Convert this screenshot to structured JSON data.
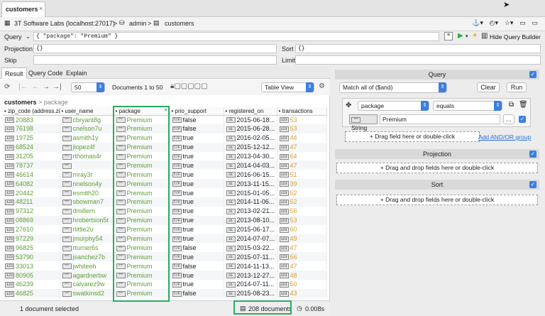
{
  "tab": {
    "title": "customers",
    "close": "×"
  },
  "breadcrumb": {
    "connection": "3T Software Labs (localhost:27017)",
    "sep1": ">",
    "database": "admin",
    "sep2": ">",
    "collection": "customers"
  },
  "query_bar": {
    "query_label": "Query",
    "query_value": "{ \"package\": \"Premium\" }",
    "projection_label": "Projection",
    "projection_value": "{}",
    "sort_label": "Sort",
    "sort_value": "{}",
    "skip_label": "Skip",
    "skip_value": "",
    "limit_label": "Limit",
    "limit_value": "",
    "query_builder_label": "Hide Query Builder"
  },
  "result_tabs": [
    "Result",
    "Query Code",
    "Explain"
  ],
  "toolbar": {
    "page_size": "50",
    "documents_range": "Documents 1 to 50",
    "view_mode": "Table View"
  },
  "path": {
    "collection": "customers",
    "sep": ">",
    "field": "package"
  },
  "columns": [
    "zip_code (address.zip",
    "user_name",
    "package",
    "prio_support",
    "registered_on",
    "transactions"
  ],
  "rows": [
    [
      "20883",
      "cbryant8g",
      "Premium",
      "false",
      "2015-06-18...",
      "53"
    ],
    [
      "76198",
      "cnelson7u",
      "Premium",
      "false",
      "2015-06-28...",
      "53"
    ],
    [
      "19725",
      "asmith1y",
      "Premium",
      "true",
      "2016-02-05...",
      "44"
    ],
    [
      "68524",
      "jlopez4f",
      "Premium",
      "true",
      "2015-12-12...",
      "47"
    ],
    [
      "31205",
      "rthomas4r",
      "Premium",
      "true",
      "2013-04-30...",
      "64"
    ],
    [
      "78737",
      "",
      "Premium",
      "true",
      "2014-04-03...",
      "47"
    ],
    [
      "46614",
      "mray3r",
      "Premium",
      "true",
      "2016-06-15...",
      "51"
    ],
    [
      "64082",
      "nnelson4y",
      "Premium",
      "true",
      "2013-11-15...",
      "39"
    ],
    [
      "20442",
      "esmith20",
      "Premium",
      "true",
      "2015-01-05...",
      "52"
    ],
    [
      "48211",
      "sbowman7",
      "Premium",
      "true",
      "2014-11-06...",
      "52"
    ],
    [
      "97312",
      "dmillern",
      "Premium",
      "true",
      "2013-02-21...",
      "56"
    ],
    [
      "08869",
      "hrobertson5t",
      "Premium",
      "true",
      "2013-08-10...",
      "53"
    ],
    [
      "27610",
      "rlittle2u",
      "Premium",
      "true",
      "2015-06-17...",
      "60"
    ],
    [
      "97229",
      "jmurphy54",
      "Premium",
      "true",
      "2014-07-07...",
      "49"
    ],
    [
      "96825",
      "rturner6s",
      "Premium",
      "false",
      "2015-03-22...",
      "47"
    ],
    [
      "53790",
      "jsanchez7b",
      "Premium",
      "true",
      "2015-07-11...",
      "56"
    ],
    [
      "33013",
      "jwhiteeh",
      "Premium",
      "false",
      "2014-11-13...",
      "47"
    ],
    [
      "80905",
      "agardnerbw",
      "Premium",
      "true",
      "2013-12-27...",
      "48"
    ],
    [
      "46239",
      "calvarez9w",
      "Premium",
      "true",
      "2014-07-11...",
      "50"
    ],
    [
      "46825",
      "swatkinsd2",
      "Premium",
      "false",
      "2015-08-23...",
      "43"
    ]
  ],
  "status": {
    "selected": "1 document selected",
    "count": "208 documents",
    "time": "0.008s"
  },
  "builder": {
    "query_title": "Query",
    "match": "Match all of ($and)",
    "clear": "Clear",
    "run": "Run",
    "field": "package",
    "operator": "equals",
    "type": "String",
    "value": "Premium",
    "more": "...",
    "drag_field": "Drag field here or double-click",
    "add_group": "Add AND/OR group",
    "projection_title": "Projection",
    "projection_drop": "Drag and drop fields here or double-click",
    "sort_title": "Sort",
    "sort_drop": "Drag and drop fields here or double-click"
  },
  "accent": "#27ae60"
}
